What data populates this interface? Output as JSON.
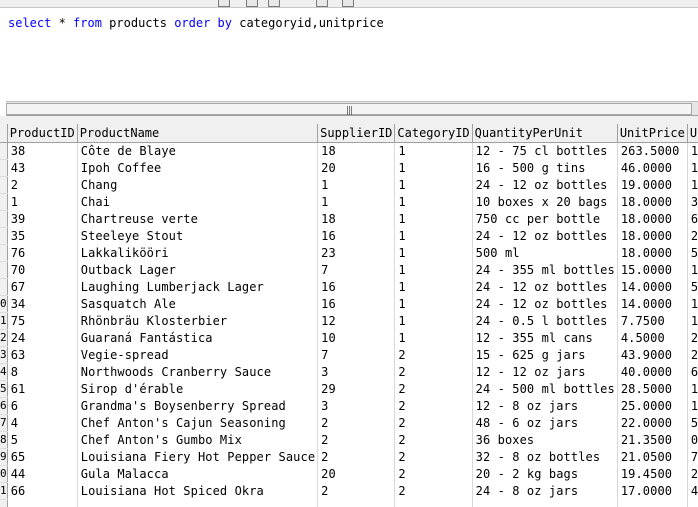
{
  "toolbar": {
    "icons": [
      "tool-icon",
      "tool-icon",
      "tool-icon",
      "tool-icon",
      "tool-icon"
    ]
  },
  "query": {
    "kw_select": "select",
    "star": " * ",
    "kw_from": "from",
    "table": " products ",
    "kw_order": "order by",
    "cols": " categoryid,unitprice"
  },
  "grid": {
    "columns": [
      "",
      "ProductID",
      "ProductName",
      "SupplierID",
      "CategoryID",
      "QuantityPerUnit",
      "UnitPrice",
      "U"
    ],
    "rows": [
      {
        "rh": "",
        "cells": [
          "38",
          "Côte de Blaye",
          "18",
          "1",
          "12 - 75 cl bottles",
          "263.5000",
          "1"
        ]
      },
      {
        "rh": "",
        "cells": [
          "43",
          "Ipoh Coffee",
          "20",
          "1",
          "16 - 500 g tins",
          "46.0000",
          "1"
        ]
      },
      {
        "rh": "",
        "cells": [
          "2",
          "Chang",
          "1",
          "1",
          "24 - 12 oz bottles",
          "19.0000",
          "1"
        ]
      },
      {
        "rh": "",
        "cells": [
          "1",
          "Chai",
          "1",
          "1",
          "10 boxes x 20 bags",
          "18.0000",
          "3"
        ]
      },
      {
        "rh": "",
        "cells": [
          "39",
          "Chartreuse verte",
          "18",
          "1",
          "750 cc per bottle",
          "18.0000",
          "6"
        ]
      },
      {
        "rh": "",
        "cells": [
          "35",
          "Steeleye Stout",
          "16",
          "1",
          "24 - 12 oz bottles",
          "18.0000",
          "2"
        ]
      },
      {
        "rh": "",
        "cells": [
          "76",
          "Lakkalikööri",
          "23",
          "1",
          "500 ml",
          "18.0000",
          "5"
        ]
      },
      {
        "rh": "",
        "cells": [
          "70",
          "Outback Lager",
          "7",
          "1",
          "24 - 355 ml bottles",
          "15.0000",
          "1"
        ]
      },
      {
        "rh": "",
        "cells": [
          "67",
          "Laughing Lumberjack Lager",
          "16",
          "1",
          "24 - 12 oz bottles",
          "14.0000",
          "5"
        ]
      },
      {
        "rh": "0",
        "cells": [
          "34",
          "Sasquatch Ale",
          "16",
          "1",
          "24 - 12 oz bottles",
          "14.0000",
          "1"
        ]
      },
      {
        "rh": "1",
        "cells": [
          "75",
          "Rhönbräu Klosterbier",
          "12",
          "1",
          "24 - 0.5 l bottles",
          "7.7500",
          "1"
        ]
      },
      {
        "rh": "2",
        "cells": [
          "24",
          "Guaraná Fantástica",
          "10",
          "1",
          "12 - 355 ml cans",
          "4.5000",
          "2"
        ]
      },
      {
        "rh": "3",
        "cells": [
          "63",
          "Vegie-spread",
          "7",
          "2",
          "15 - 625 g jars",
          "43.9000",
          "2"
        ]
      },
      {
        "rh": "4",
        "cells": [
          "8",
          "Northwoods Cranberry Sauce",
          "3",
          "2",
          "12 - 12 oz jars",
          "40.0000",
          "6"
        ]
      },
      {
        "rh": "5",
        "cells": [
          "61",
          "Sirop d'érable",
          "29",
          "2",
          "24 - 500 ml bottles",
          "28.5000",
          "1"
        ]
      },
      {
        "rh": "6",
        "cells": [
          "6",
          "Grandma's Boysenberry Spread",
          "3",
          "2",
          "12 - 8 oz jars",
          "25.0000",
          "1"
        ]
      },
      {
        "rh": "7",
        "cells": [
          "4",
          "Chef Anton's Cajun Seasoning",
          "2",
          "2",
          "48 - 6 oz jars",
          "22.0000",
          "5"
        ]
      },
      {
        "rh": "8",
        "cells": [
          "5",
          "Chef Anton's Gumbo Mix",
          "2",
          "2",
          "36 boxes",
          "21.3500",
          "0"
        ]
      },
      {
        "rh": "9",
        "cells": [
          "65",
          "Louisiana Fiery Hot Pepper Sauce",
          "2",
          "2",
          "32 - 8 oz bottles",
          "21.0500",
          "7"
        ]
      },
      {
        "rh": "0",
        "cells": [
          "44",
          "Gula Malacca",
          "20",
          "2",
          "20 - 2 kg bags",
          "19.4500",
          "2"
        ]
      },
      {
        "rh": "1",
        "cells": [
          "66",
          "Louisiana Hot Spiced Okra",
          "2",
          "2",
          "24 - 8 oz jars",
          "17.0000",
          "4"
        ]
      },
      {
        "rh": "",
        "cells": [
          "",
          "",
          "",
          "",
          "",
          "",
          ""
        ]
      }
    ]
  }
}
